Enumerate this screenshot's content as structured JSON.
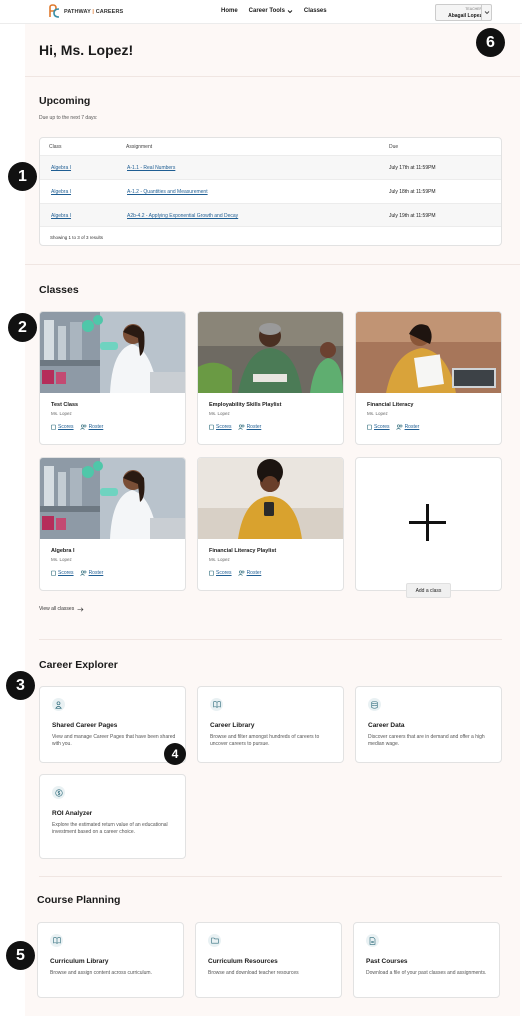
{
  "nav": {
    "logo_text_a": "PATHWAY",
    "logo_sep": "|",
    "logo_text_b": "CAREERS",
    "links": [
      "Home",
      "Career Tools",
      "Classes"
    ],
    "user_role": "TEACHER",
    "user_name": "Abagail Lopez"
  },
  "greeting": "Hi, Ms. Lopez!",
  "upcoming": {
    "title": "Upcoming",
    "subtitle": "Due up to the next 7 days:",
    "headers": [
      "Class",
      "Assignment",
      "Due"
    ],
    "rows": [
      {
        "class": "Algebra I",
        "assignment": "A-1.1 - Real Numbers",
        "due": "July 17th at 11:59PM"
      },
      {
        "class": "Algebra I",
        "assignment": "A-1.2 - Quantities and Measurement",
        "due": "July 18th at 11:59PM"
      },
      {
        "class": "Algebra I",
        "assignment": "A2b-4.2 - Applying Exponential Growth and Decay",
        "due": "July 19th at 11:59PM"
      }
    ],
    "footer": "Showing 1 to 3 of 3 results"
  },
  "classes": {
    "title": "Classes",
    "scores_label": "Scores",
    "roster_label": "Roster",
    "items": [
      {
        "name": "Test Class",
        "teacher": "Ms. Lopez"
      },
      {
        "name": "Employability Skills Playlist",
        "teacher": "Ms. Lopez"
      },
      {
        "name": "Financial Literacy",
        "teacher": "Ms. Lopez"
      },
      {
        "name": "Algebra I",
        "teacher": "Ms. Lopez"
      },
      {
        "name": "Financial Literacy Playlist",
        "teacher": "Ms. Lopez"
      }
    ],
    "add_label": "Add a class",
    "view_all": "View all classes"
  },
  "career_explorer": {
    "title": "Career Explorer",
    "items": [
      {
        "title": "Shared Career Pages",
        "desc": "View and manage Career Pages that have been shared with you.",
        "icon": "person-icon"
      },
      {
        "title": "Career Library",
        "desc": "Browse and filter amongst hundreds of careers to uncover careers to pursue.",
        "icon": "book-icon"
      },
      {
        "title": "Career Data",
        "desc": "Discover careers that are in demand and offer a high median wage.",
        "icon": "database-icon"
      },
      {
        "title": "ROI Analyzer",
        "desc": "Explore the estimated return value of an educational investment based on a career choice.",
        "icon": "dollar-icon"
      }
    ]
  },
  "course_planning": {
    "title": "Course Planning",
    "items": [
      {
        "title": "Curriculum Library",
        "desc": "Browse and assign content across curriculum.",
        "icon": "book-icon"
      },
      {
        "title": "Curriculum Resources",
        "desc": "Browse and download teacher resources",
        "icon": "folder-icon"
      },
      {
        "title": "Past Courses",
        "desc": "Download a file of your past classes and assignments.",
        "icon": "file-icon"
      }
    ]
  },
  "badges": [
    "1",
    "2",
    "3",
    "4",
    "5",
    "6"
  ],
  "colors": {
    "accent": "#1f5e93",
    "page_bg": "#fdf8f6",
    "icon_tint": "#2d6a7a"
  }
}
